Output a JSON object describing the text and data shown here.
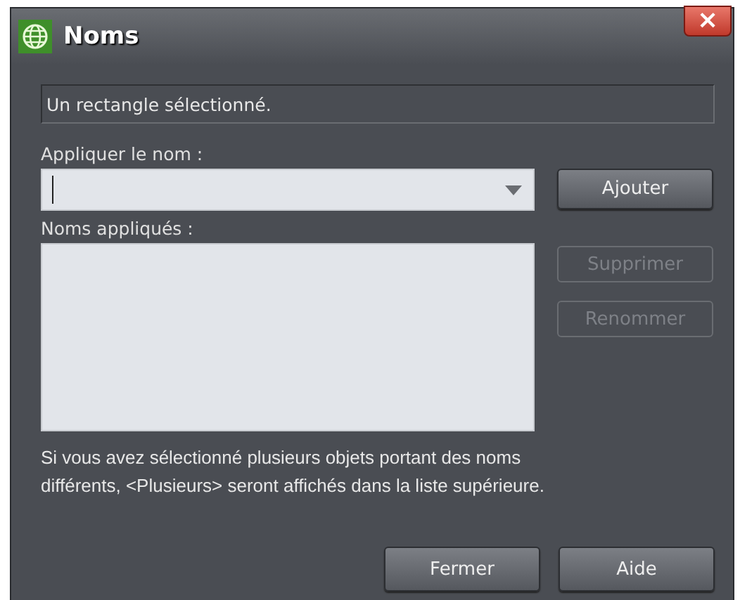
{
  "window": {
    "title": "Noms",
    "close": "×"
  },
  "status": "Un rectangle sélectionné.",
  "apply_label": "Appliquer le nom :",
  "add_button": {
    "label": "Ajouter",
    "disabled": false
  },
  "applied_label": "Noms appliqués :",
  "side_buttons": [
    {
      "label": "Supprimer",
      "disabled": true
    },
    {
      "label": "Renommer",
      "disabled": true
    }
  ],
  "note": "Si vous avez sélectionné plusieurs objets portant des noms\ndifférents, <Plusieurs> seront affichés dans la liste supérieure.",
  "footer_buttons": [
    {
      "label": "Fermer",
      "disabled": false
    },
    {
      "label": "Aide",
      "disabled": false
    }
  ]
}
